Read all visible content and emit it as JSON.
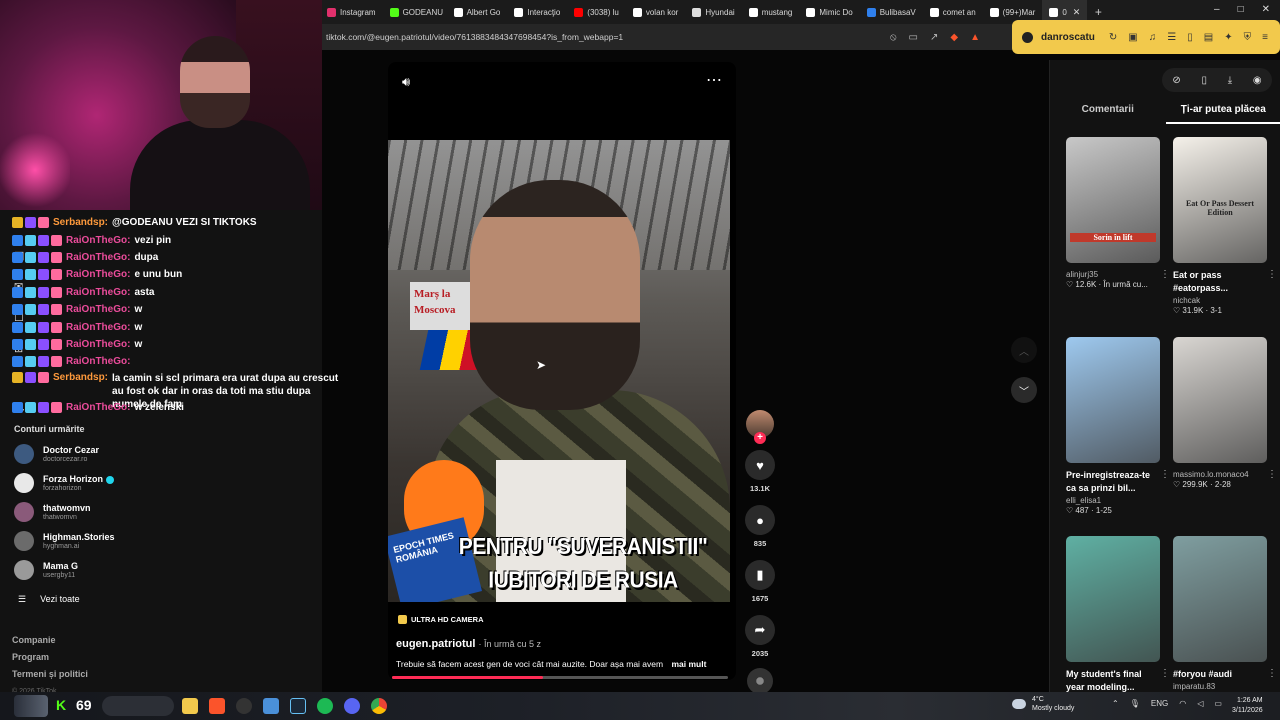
{
  "browser": {
    "tabs": [
      {
        "label": "Instagram",
        "color": "#e1306c"
      },
      {
        "label": "GODEANU",
        "color": "#53fc18"
      },
      {
        "label": "Albert Go",
        "color": "#ffffff"
      },
      {
        "label": "Interacţio",
        "color": "#ffffff"
      },
      {
        "label": "(3038) lu",
        "color": "#ff0000"
      },
      {
        "label": "volan kor",
        "color": "#ffffff"
      },
      {
        "label": "Hyundai",
        "color": "#dddddd"
      },
      {
        "label": "mustang",
        "color": "#ffffff"
      },
      {
        "label": "Mimic Do",
        "color": "#ffffff"
      },
      {
        "label": "BulibasaV",
        "color": "#2f80ed"
      },
      {
        "label": "comet an",
        "color": "#ffffff"
      },
      {
        "label": "(99+)Mar",
        "color": "#ffffff"
      },
      {
        "label": "0",
        "color": "#ffffff"
      }
    ],
    "url": "tiktok.com/@eugen.patriotul/video/7613883484347698454?is_from_webapp=1",
    "profile_name": "danroscatu",
    "window_controls": [
      "–",
      "□",
      "✕"
    ]
  },
  "chat": {
    "lines": [
      {
        "user": "Serbandsp:",
        "msg": "@GODEANU VEZI SI TIKTOKS",
        "kind": "serb"
      },
      {
        "user": "RaiOnTheGo:",
        "msg": "vezi pin",
        "kind": "rai"
      },
      {
        "user": "RaiOnTheGo:",
        "msg": "dupa",
        "kind": "rai"
      },
      {
        "user": "RaiOnTheGo:",
        "msg": "e unu bun",
        "kind": "rai"
      },
      {
        "user": "RaiOnTheGo:",
        "msg": "asta",
        "kind": "rai"
      },
      {
        "user": "RaiOnTheGo:",
        "msg": "w",
        "kind": "rai"
      },
      {
        "user": "RaiOnTheGo:",
        "msg": "w",
        "kind": "rai"
      },
      {
        "user": "RaiOnTheGo:",
        "msg": "w",
        "kind": "rai"
      },
      {
        "user": "RaiOnTheGo:",
        "msg": "",
        "kind": "rai"
      },
      {
        "user": "Serbandsp:",
        "msg": "la camin si scl primara era urat dupa au crescut au fost ok dar in oras da toti ma stiu dupa numele de fam",
        "kind": "serb",
        "wrap": true
      },
      {
        "user": "RaiOnTheGo:",
        "msg": "w zelenski",
        "kind": "rai"
      }
    ]
  },
  "sidebar": {
    "following_title": "Conturi urmărite",
    "accounts": [
      {
        "name": "Doctor Cezar",
        "handle": "doctorcezar.ro",
        "verified": false,
        "color": "#3d5a80"
      },
      {
        "name": "Forza Horizon",
        "handle": "forzahorizon",
        "verified": true,
        "color": "#e8e8e8"
      },
      {
        "name": "thatwomvn",
        "handle": "thatwomvn",
        "verified": false,
        "color": "#8a5a7a"
      },
      {
        "name": "Highman.Stories",
        "handle": "hyghman.ai",
        "verified": false,
        "color": "#6b6b6b"
      },
      {
        "name": "Mama G",
        "handle": "usergby11",
        "verified": false,
        "color": "#9a9a9a"
      }
    ],
    "see_all": "Vezi toate",
    "footer_links": [
      "Companie",
      "Program",
      "Termeni și politici"
    ],
    "copyright": "© 2026 TikTok"
  },
  "video": {
    "sign_text": "Marș la Moscova",
    "overlay_line1": "PENTRU \"SUVERANISTII\"",
    "overlay_line2": "IUBITORI DE RUSIA",
    "mic_text": "EPOCH TIMES ROMÂNIA",
    "label": "ULTRA HD CAMERA",
    "author": "eugen.patriotul",
    "time": "· În urmă cu 5 z",
    "description": "Trebuie să facem acest gen de voci cât mai auzite. Doar așa mai avem",
    "more": "mai mult",
    "progress": 0.45
  },
  "actions": {
    "likes": "13.1K",
    "comments": "835",
    "saves": "1675",
    "shares": "2035"
  },
  "rightpanel": {
    "tabs": [
      "Comentarii",
      "Ți-ar putea plăcea"
    ],
    "cards": [
      {
        "title": "",
        "author": "alinjurj35",
        "stats": "12.6K · În urmă cu...",
        "thumb_text": "Sorin în lift",
        "bg": "#c8c8c8"
      },
      {
        "title": "Eat or pass #eatorpass...",
        "author": "nichcak",
        "stats": "31.9K · 3-1",
        "thumb_text": "Eat Or Pass Dessert Edition",
        "bg": "#f5f1ea"
      },
      {
        "title": "Pre-inregistreaza-te ca sa prinzi bil...",
        "author": "elli_elisa1",
        "stats": "487 · 1-25",
        "thumb_text": "",
        "bg": "#9ec9ef"
      },
      {
        "title": "",
        "author": "massimo.lo.monaco4",
        "stats": "299.9K · 2-28",
        "thumb_text": "",
        "bg": "#d9d6d2"
      },
      {
        "title": "My student's final year modeling...",
        "author": "",
        "stats": "",
        "thumb_text": "",
        "bg": "#5fb0a3"
      },
      {
        "title": "#foryou #audi",
        "author": "imparatu.83",
        "stats": "",
        "thumb_text": "",
        "bg": "#7f9ea0"
      }
    ]
  },
  "taskbar": {
    "kick_count": "69",
    "weather_temp": "4°C",
    "weather_desc": "Mostly cloudy",
    "lang": "ENG",
    "time": "1:26 AM",
    "date": "3/11/2026"
  }
}
